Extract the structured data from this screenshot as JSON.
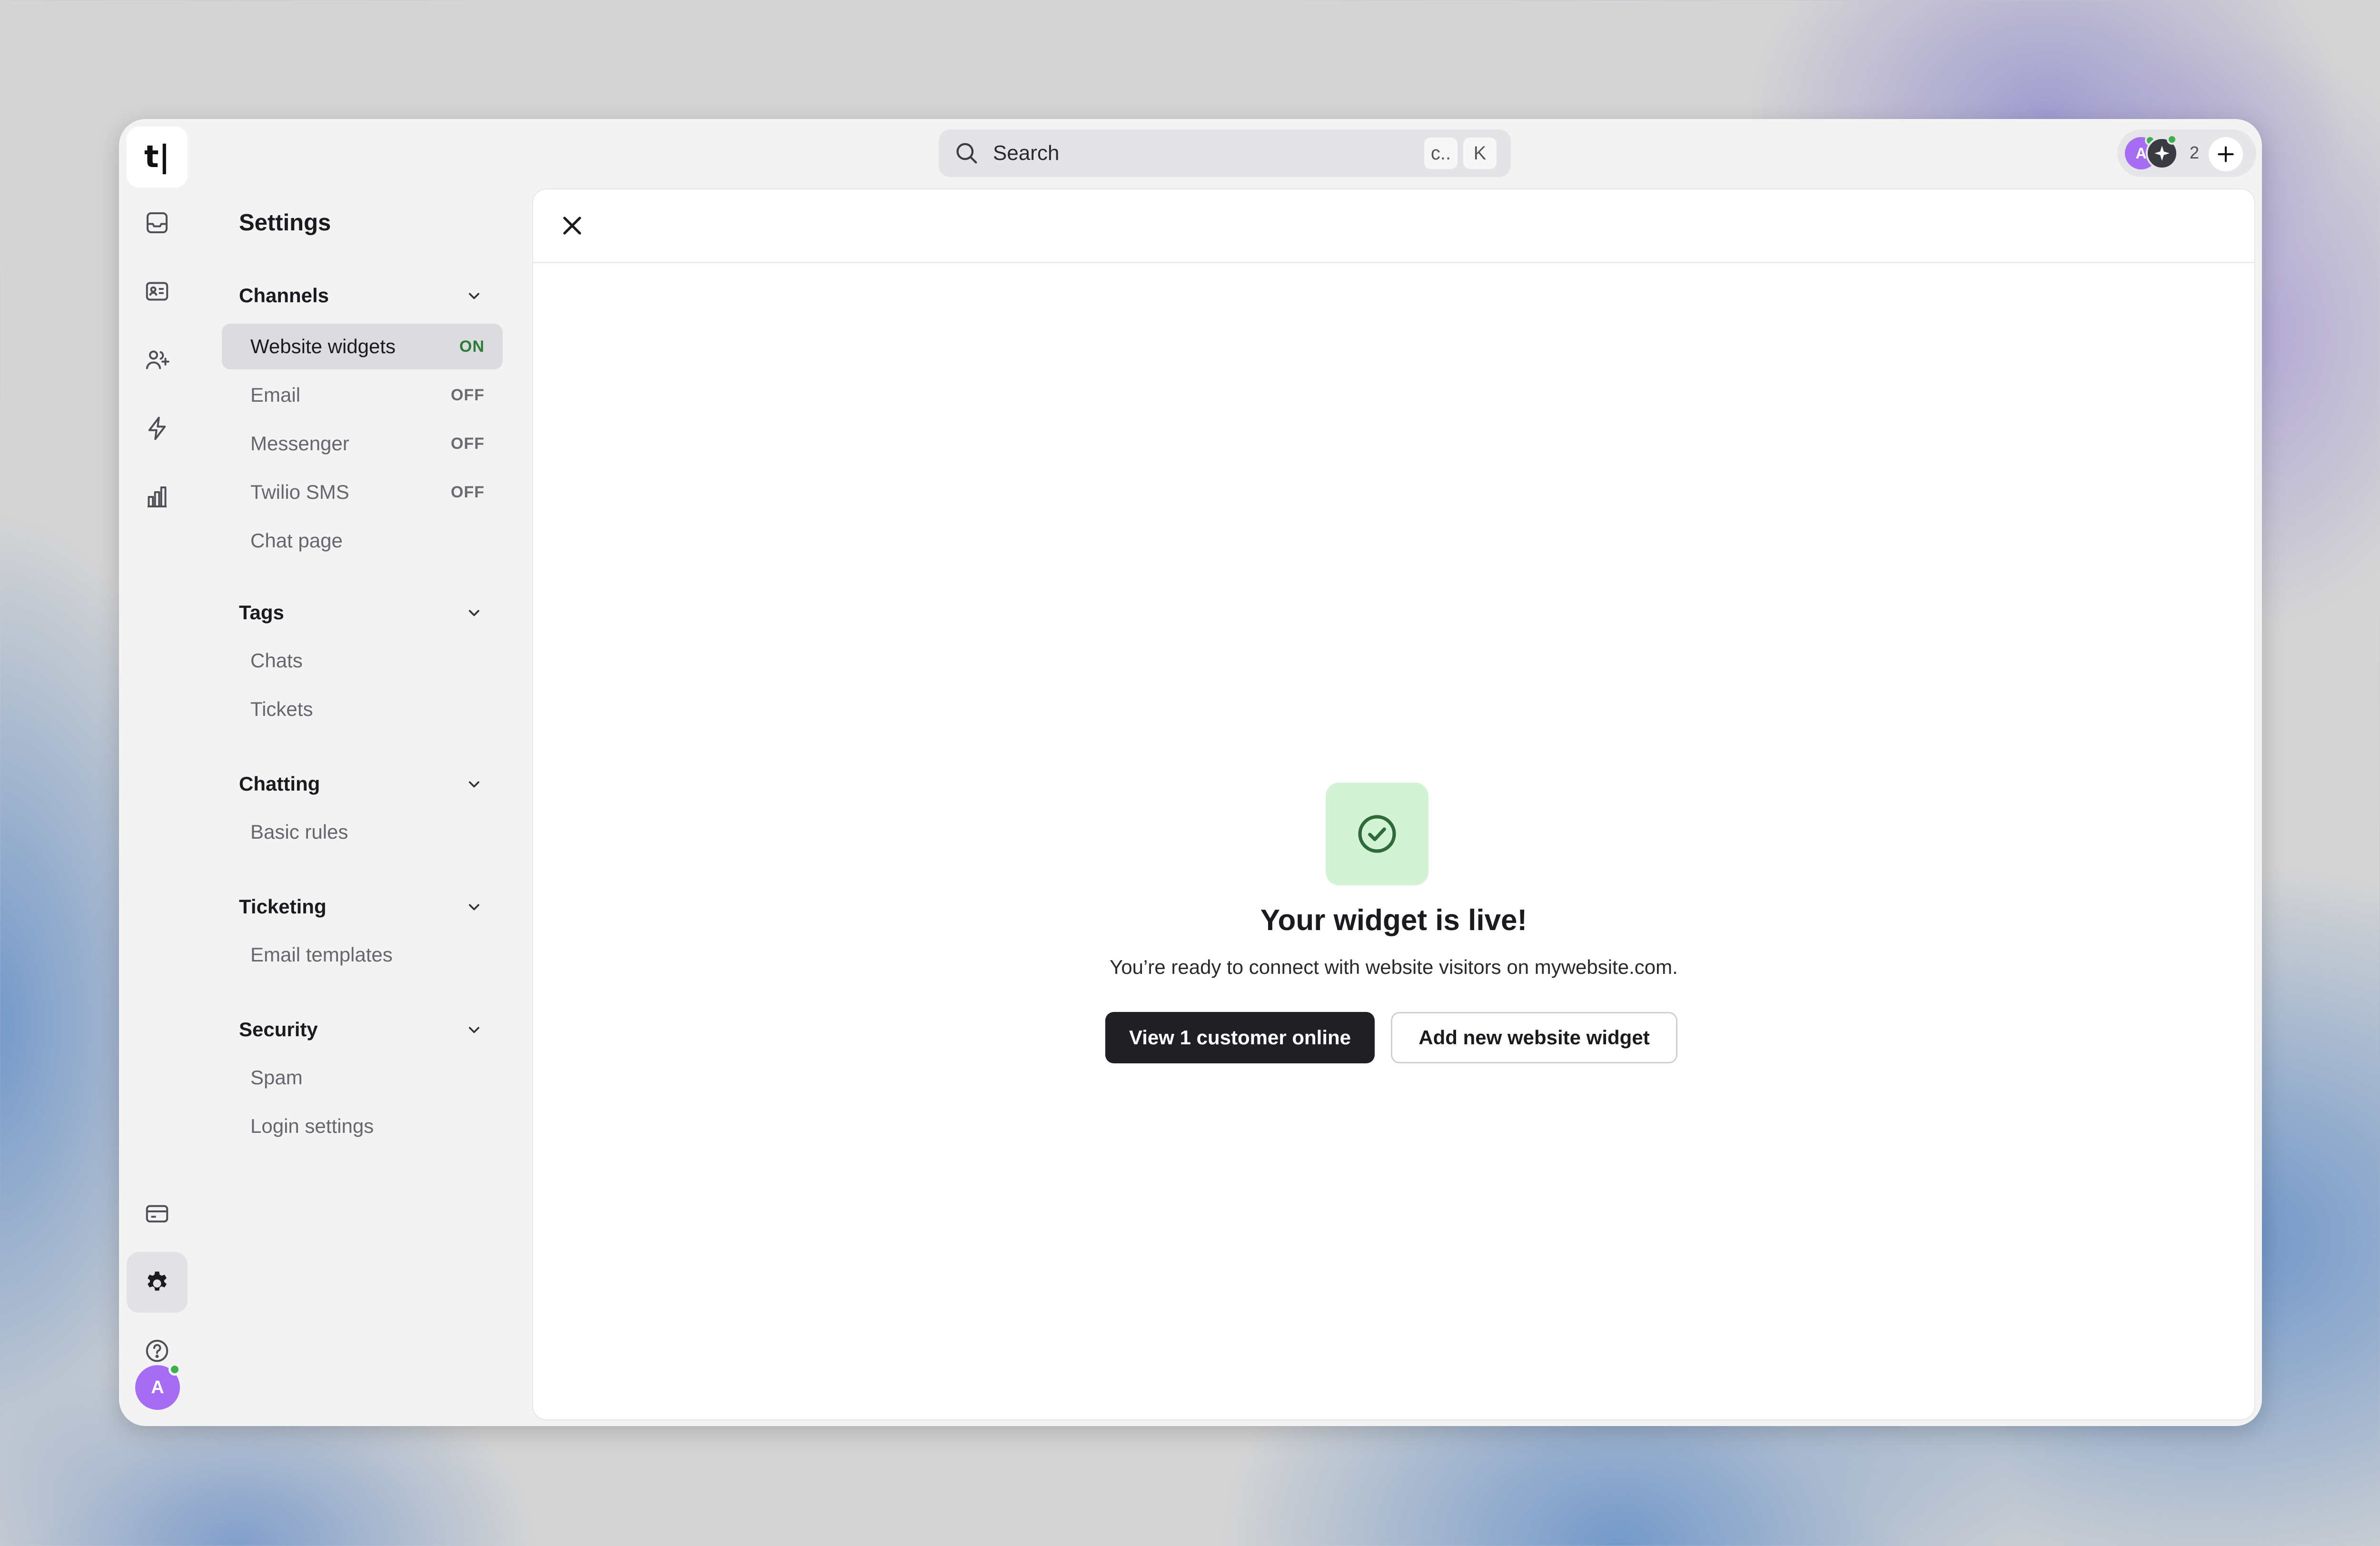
{
  "app": {
    "logo_text": "t|"
  },
  "search": {
    "placeholder": "Search",
    "shortcut_keys": [
      "c..",
      "K"
    ]
  },
  "presence": {
    "avatar_letter": "A",
    "online_count": "2"
  },
  "rail": {
    "icons": [
      "inbox-icon",
      "contact-card-icon",
      "add-users-icon",
      "bolt-icon",
      "bar-chart-icon",
      "billing-card-icon",
      "gear-icon",
      "help-icon"
    ],
    "user_avatar_letter": "A"
  },
  "settings": {
    "title": "Settings",
    "sections": [
      {
        "title": "Channels",
        "items": [
          {
            "label": "Website widgets",
            "status": "ON",
            "active": true
          },
          {
            "label": "Email",
            "status": "OFF"
          },
          {
            "label": "Messenger",
            "status": "OFF"
          },
          {
            "label": "Twilio SMS",
            "status": "OFF"
          },
          {
            "label": "Chat page"
          }
        ]
      },
      {
        "title": "Tags",
        "items": [
          {
            "label": "Chats"
          },
          {
            "label": "Tickets"
          }
        ]
      },
      {
        "title": "Chatting",
        "items": [
          {
            "label": "Basic rules"
          }
        ]
      },
      {
        "title": "Ticketing",
        "items": [
          {
            "label": "Email templates"
          }
        ]
      },
      {
        "title": "Security",
        "items": [
          {
            "label": "Spam"
          },
          {
            "label": "Login settings"
          }
        ]
      }
    ]
  },
  "main": {
    "headline": "Your widget is live!",
    "subtext": "You’re ready to connect with website visitors on mywebsite.com.",
    "primary_button": "View 1 customer online",
    "secondary_button": "Add new website widget"
  },
  "colors": {
    "success_bg": "#d4f3d6",
    "success_icon": "#2f6a3a",
    "on_status": "#2d7a3a",
    "primary_button": "#1f1f24"
  }
}
